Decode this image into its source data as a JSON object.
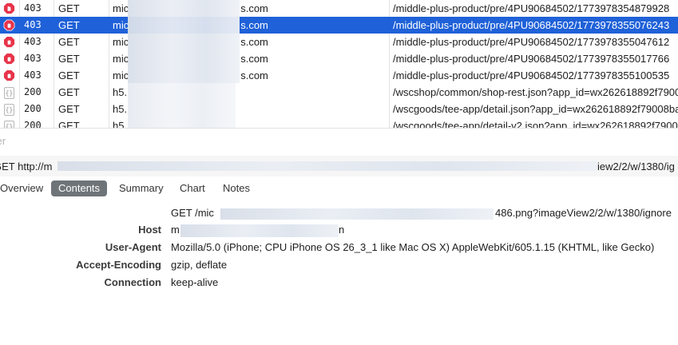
{
  "requests": [
    {
      "status": "403",
      "method": "GET",
      "host_start": "mic",
      "host_end": "s.com",
      "path": "/middle-plus-product/pre/4PU90684502/1773978354879928",
      "icon": "error-icon",
      "selected": false
    },
    {
      "status": "403",
      "method": "GET",
      "host_start": "mic",
      "host_end": "s.com",
      "path": "/middle-plus-product/pre/4PU90684502/1773978355076243",
      "icon": "error-icon",
      "selected": true
    },
    {
      "status": "403",
      "method": "GET",
      "host_start": "mic",
      "host_end": "s.com",
      "path": "/middle-plus-product/pre/4PU90684502/1773978355047612",
      "icon": "error-icon",
      "selected": false
    },
    {
      "status": "403",
      "method": "GET",
      "host_start": "mic",
      "host_end": "s.com",
      "path": "/middle-plus-product/pre/4PU90684502/1773978355017766",
      "icon": "error-icon",
      "selected": false
    },
    {
      "status": "403",
      "method": "GET",
      "host_start": "mic",
      "host_end": "s.com",
      "path": "/middle-plus-product/pre/4PU90684502/1773978355100535",
      "icon": "error-icon",
      "selected": false
    },
    {
      "status": "200",
      "method": "GET",
      "host_start": "h5.",
      "host_end": "",
      "path": "/wscshop/common/shop-rest.json?app_id=wx262618892f7900",
      "icon": "json-icon",
      "selected": false
    },
    {
      "status": "200",
      "method": "GET",
      "host_start": "h5.",
      "host_end": "",
      "path": "/wscgoods/tee-app/detail.json?app_id=wx262618892f79008ba",
      "icon": "json-icon",
      "selected": false
    },
    {
      "status": "200",
      "method": "GET",
      "host_start": "h5.",
      "host_end": "",
      "path": "/wscgoods/tee-app/detail-v2.json?app_id=wx262618892f7900",
      "icon": "json-icon",
      "selected": false
    }
  ],
  "filter": {
    "placeholder": "ter"
  },
  "request_line": {
    "start": "GET http://m",
    "end": "iew2/2/w/1380/ig"
  },
  "tabs": [
    "Overview",
    "Contents",
    "Summary",
    "Chart",
    "Notes"
  ],
  "active_tab": "Contents",
  "headers": {
    "request_line_start": "GET /mic",
    "request_line_end": "486.png?imageView2/2/w/1380/ignore",
    "rows": [
      {
        "key": "Host",
        "val_start": "m",
        "val_end": "n"
      },
      {
        "key": "User-Agent",
        "value": "Mozilla/5.0 (iPhone; CPU iPhone OS 26_3_1 like Mac OS X) AppleWebKit/605.1.15 (KHTML, like Gecko)"
      },
      {
        "key": "Accept-Encoding",
        "value": "gzip, deflate"
      },
      {
        "key": "Connection",
        "value": "keep-alive"
      }
    ]
  },
  "colors": {
    "selection": "#1f61d8",
    "error_icon": "#e8334a",
    "active_tab": "#6f7478"
  }
}
